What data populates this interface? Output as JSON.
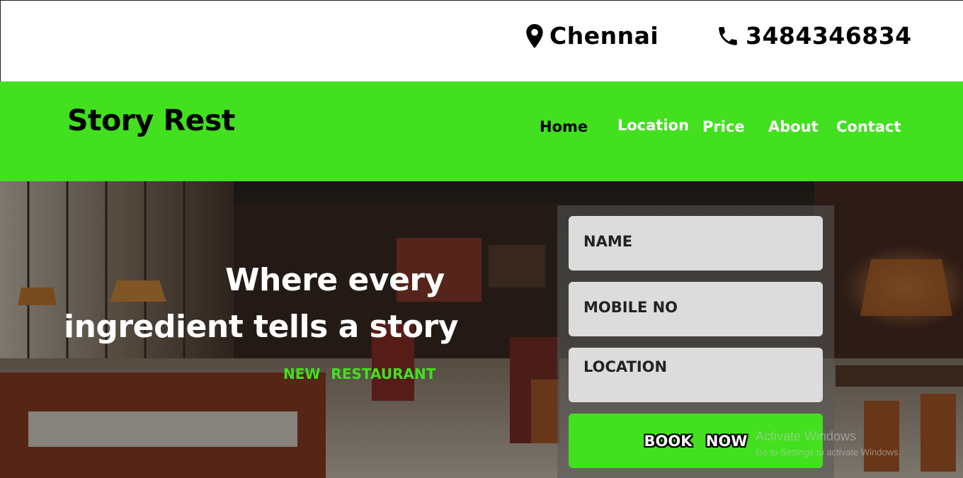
{
  "contact": {
    "city": "Chennai",
    "phone": "3484346834",
    "city_icon": "location-pin-icon",
    "phone_icon": "phone-icon"
  },
  "header": {
    "brand": "Story Rest",
    "nav": [
      {
        "label": "Home",
        "active": true
      },
      {
        "label": "Location"
      },
      {
        "label": "Price"
      },
      {
        "label": "About"
      },
      {
        "label": "Contact"
      }
    ]
  },
  "hero": {
    "headline_line1": "Where every",
    "headline_line2": "ingredient tells a story",
    "tagline": "NEW RESTAURANT"
  },
  "booking_form": {
    "name_placeholder": "NAME",
    "mobile_placeholder": "MOBILE NO",
    "location_placeholder": "LOCATION",
    "submit_label": "BOOK NOW"
  },
  "os_watermark": {
    "title": "Activate Windows",
    "subtitle": "Go to Settings to activate Windows."
  },
  "colors": {
    "accent_green": "#42e01f",
    "field_bg": "#dcdcdc"
  }
}
